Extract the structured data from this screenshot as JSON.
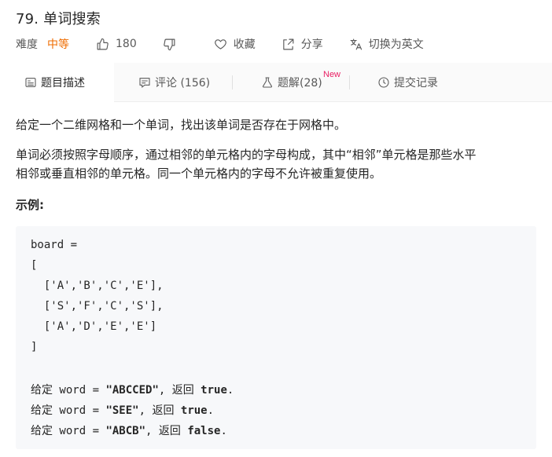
{
  "problem": {
    "title": "79. 单词搜索",
    "difficulty_label": "难度",
    "difficulty_value": "中等",
    "likes": "180",
    "favorite_label": "收藏",
    "share_label": "分享",
    "translate_label": "切换为英文"
  },
  "tabs": [
    {
      "label": "题目描述",
      "icon": "description-icon"
    },
    {
      "label": "评论 (156)",
      "icon": "comment-icon"
    },
    {
      "label": "题解(28)",
      "icon": "flask-icon",
      "badge": "New"
    },
    {
      "label": "提交记录",
      "icon": "clock-icon"
    }
  ],
  "description": {
    "para1": "给定一个二维网格和一个单词，找出该单词是否存在于网格中。",
    "para2_line1": "单词必须按照字母顺序，通过相邻的单元格内的字母构成，其中“相邻”单元格是那些水平",
    "para2_line2": "相邻或垂直相邻的单元格。同一个单元格内的字母不允许被重复使用。",
    "example_heading": "示例:"
  },
  "example": {
    "line1": "board =",
    "line2": "[",
    "line3": "  ['A','B','C','E'],",
    "line4": "  ['S','F','C','S'],",
    "line5": "  ['A','D','E','E']",
    "line6": "]",
    "calls": [
      {
        "prefix": "给定",
        "var": " word = ",
        "word": "\"ABCCED\"",
        "sep": ", ",
        "ret": "返回",
        "result": "true",
        "end": "."
      },
      {
        "prefix": "给定",
        "var": " word = ",
        "word": "\"SEE\"",
        "sep": ", ",
        "ret": "返回",
        "result": "true",
        "end": "."
      },
      {
        "prefix": "给定",
        "var": " word = ",
        "word": "\"ABCB\"",
        "sep": ", ",
        "ret": "返回",
        "result": "false",
        "end": "."
      }
    ]
  },
  "colors": {
    "difficulty": "#ef6c00",
    "new_badge": "#e91e63",
    "code_bg": "#f7f8fa"
  }
}
